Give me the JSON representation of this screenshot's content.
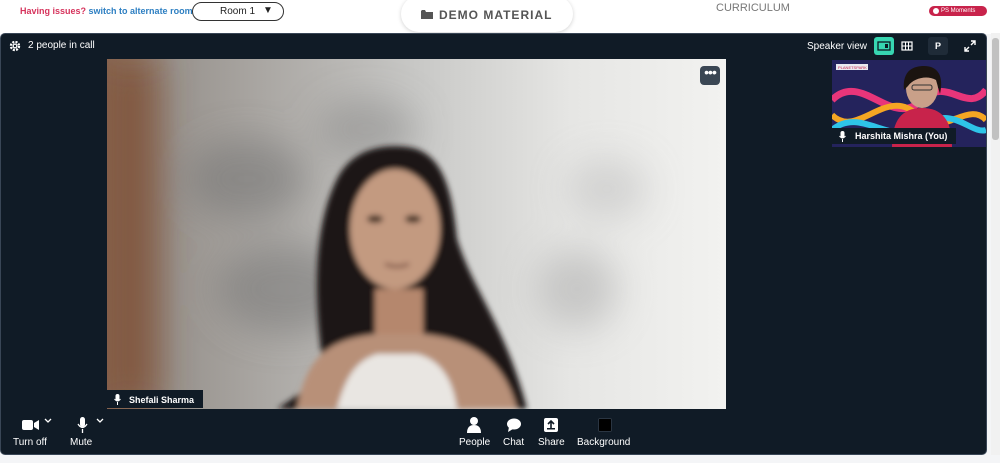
{
  "topbar": {
    "issues_text": "Having issues?",
    "switch_link": "switch to alternate room",
    "room_value": "Room 1",
    "demo_material": "DEMO MATERIAL",
    "curriculum": "CURRICULUM",
    "ps_moments": "PS Moments"
  },
  "call": {
    "people_count": "2 people in call",
    "view_label": "Speaker view",
    "p_button": "P",
    "main_participant": "Shefali Sharma",
    "self_participant": "Harshita Mishra (You)"
  },
  "controls": {
    "camera": "Turn off",
    "mic": "Mute",
    "people": "People",
    "chat": "Chat",
    "share": "Share",
    "background": "Background"
  },
  "colors": {
    "accent": "#37d6b1",
    "alert_red": "#d6335c",
    "link_blue": "#2d7fc2",
    "call_bg": "#101b26"
  },
  "icons": [
    "gear-icon",
    "speaker-layout-icon",
    "grid-layout-icon",
    "expand-icon",
    "more-icon",
    "mic-icon",
    "camera-icon",
    "chevron-down-icon",
    "people-icon",
    "chat-icon",
    "share-icon",
    "background-icon",
    "folder-icon"
  ]
}
